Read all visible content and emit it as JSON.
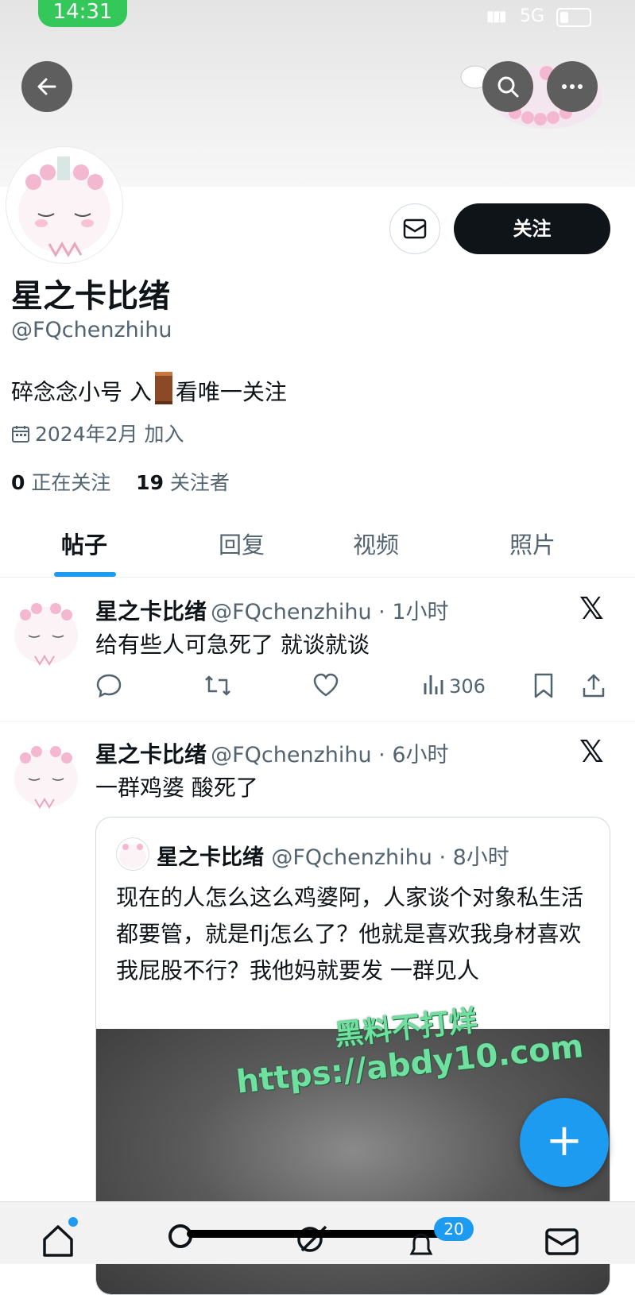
{
  "status_bar": {
    "time": "14:31",
    "network": "5G"
  },
  "profile": {
    "name": "星之卡比绪",
    "handle": "@FQchenzhihu",
    "bio_before": "碎念念小号 入",
    "bio_after": "看唯一关注",
    "joined": "2024年2月 加入",
    "following_count": "0",
    "following_label": "正在关注",
    "followers_count": "19",
    "followers_label": "关注者",
    "follow_button": "关注"
  },
  "tabs": [
    {
      "label": "帖子",
      "active": true
    },
    {
      "label": "回复",
      "active": false
    },
    {
      "label": "视频",
      "active": false
    },
    {
      "label": "照片",
      "active": false
    }
  ],
  "posts": [
    {
      "name": "星之卡比绪",
      "handle_time": "@FQchenzhihu · 1小时",
      "text": "给有些人可急死了 就谈就谈",
      "views": "306"
    },
    {
      "name": "星之卡比绪",
      "handle_time": "@FQchenzhihu · 6小时",
      "text": "一群鸡婆 酸死了",
      "quote": {
        "name": "星之卡比绪",
        "handle_time": "@FQchenzhihu · 8小时",
        "text": "现在的人怎么这么鸡婆阿，人家谈个对象私生活都要管，就是flj怎么了？他就是喜欢我身材喜欢我屁股不行？我他妈就要发 一群见人"
      }
    }
  ],
  "watermark": {
    "line1": "黑料不打烊",
    "line2": "https://abdy10.com"
  },
  "bottom_nav": {
    "badge": "20"
  },
  "colors": {
    "accent": "#1d9bf0",
    "follow_bg": "#0f1419",
    "status_green": "#34c759"
  }
}
